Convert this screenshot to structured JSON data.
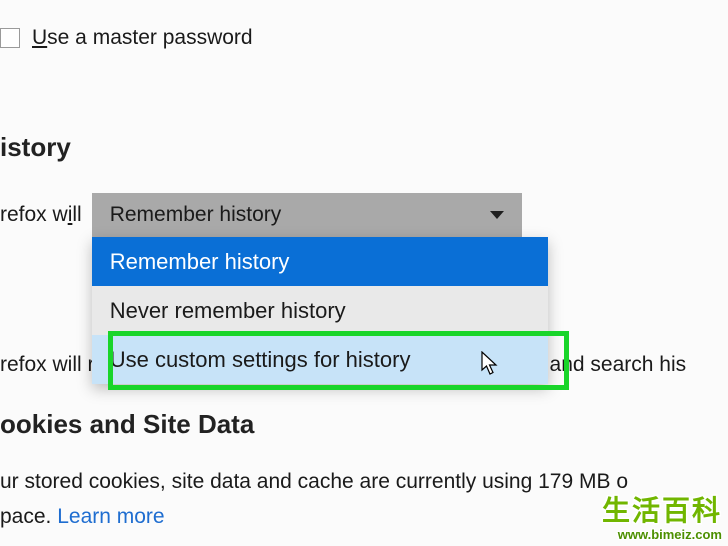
{
  "master_password": {
    "label_prefix": "U",
    "label_rest": "se a master password"
  },
  "history": {
    "heading": "istory",
    "prefix_label": "refox w",
    "prefix_accesskey": "i",
    "prefix_suffix": "ll",
    "dropdown": {
      "selected": "Remember history",
      "options": [
        "Remember history",
        "Never remember history",
        "Use custom settings for history"
      ]
    },
    "desc_prefix": "refox will r",
    "desc_suffix": "m and search his"
  },
  "cookies": {
    "heading": "ookies and Site Data",
    "desc_line1": "ur stored cookies, site data and cache are currently using 179 MB o",
    "desc_line2_prefix": "pace.  ",
    "learn_more": "Learn more"
  },
  "watermark": {
    "text": "生活百科",
    "url": "www.bimeiz.com"
  }
}
